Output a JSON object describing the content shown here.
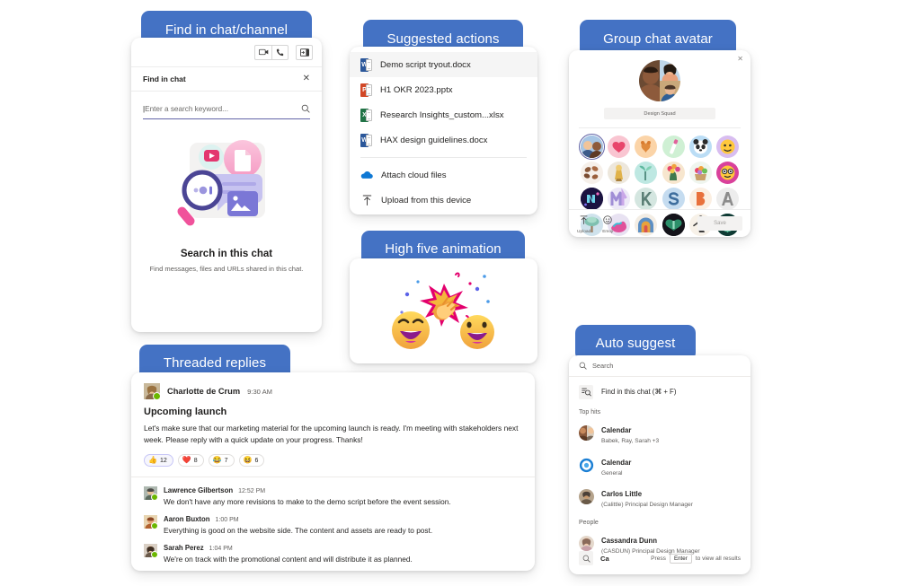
{
  "theme": {
    "tab_blue": "#4472C4",
    "accent_purple": "#6264A7",
    "presence_green": "#6BB700"
  },
  "tabs": {
    "find_in_chat_channel": "Find in chat/channel",
    "suggested_actions": "Suggested actions",
    "group_chat_avatar": "Group chat avatar",
    "high_five_animation": "High five animation",
    "threaded_replies": "Threaded replies",
    "auto_suggest": "Auto suggest"
  },
  "find_in_chat": {
    "toolbar_icons": [
      "video-camera-icon",
      "phone-icon",
      "open-panel-icon"
    ],
    "header_title": "Find in chat",
    "close_label": "✕",
    "search_placeholder": "Enter a search keyword...",
    "search_icon": "search-icon",
    "empty_title": "Search in this chat",
    "empty_subtitle": "Find messages, files and URLs shared in this chat."
  },
  "suggested_actions": {
    "files": [
      {
        "name": "Demo script tryout.docx",
        "type": "word",
        "badge": "W",
        "selected": true
      },
      {
        "name": "H1 OKR 2023.pptx",
        "type": "powerpoint",
        "badge": "P",
        "selected": false
      },
      {
        "name": "Research Insights_custom...xlsx",
        "type": "excel",
        "badge": "X",
        "selected": false
      },
      {
        "name": "HAX design guidelines.docx",
        "type": "word",
        "badge": "W",
        "selected": false
      }
    ],
    "actions": [
      {
        "label": "Attach cloud files",
        "icon": "cloud-icon"
      },
      {
        "label": "Upload from this device",
        "icon": "upload-arrow-icon"
      }
    ]
  },
  "group_chat_avatar": {
    "close_label": "✕",
    "group_name": "Design Squad",
    "avatar_options_count": 24,
    "selected_index": 0,
    "footer": {
      "upload_label": "Upload",
      "upload_icon": "upload-arrow-icon",
      "emoji_label": "Emoji",
      "emoji_icon": "smiley-icon",
      "save_label": "Save"
    }
  },
  "high_five": {
    "emoji_left": "😁",
    "emoji_right": "😁",
    "hands": "👏",
    "burst_color": "#E3006D"
  },
  "threaded_replies": {
    "author": "Charlotte de Crum",
    "time": "9:30 AM",
    "subject": "Upcoming launch",
    "body": "Let's make sure that our marketing material for the upcoming launch is ready. I'm meeting with stakeholders next week. Please reply with a quick update on your progress. Thanks!",
    "reactions": [
      {
        "emoji": "👍",
        "count": "12"
      },
      {
        "emoji": "❤️",
        "count": "8"
      },
      {
        "emoji": "😂",
        "count": "7"
      },
      {
        "emoji": "😆",
        "count": "6"
      }
    ],
    "replies": [
      {
        "author": "Lawrence Gilbertson",
        "time": "12:52 PM",
        "text": "We don't have any more revisions to make to the demo script before the event session."
      },
      {
        "author": "Aaron Buxton",
        "time": "1:00 PM",
        "text": "Everything is good on the website side. The content and assets are ready to post."
      },
      {
        "author": "Sarah Perez",
        "time": "1:04 PM",
        "text": "We're on track with the promotional content and will distribute it as planned."
      }
    ]
  },
  "auto_suggest": {
    "search_placeholder": "Search",
    "search_icon": "search-icon",
    "find_in_chat_label": "Find in this chat (⌘ + F)",
    "find_in_chat_icon": "filter-search-icon",
    "top_hits_label": "Top hits",
    "top_hits": [
      {
        "title": "Calendar",
        "subtitle": "Babek, Ray, Sarah +3",
        "avatar": "group-photo"
      },
      {
        "title": "Calendar",
        "subtitle": "General",
        "avatar": "teams-channel-icon"
      },
      {
        "title": "Carlos Little",
        "subtitle": "(Calittle) Principal Design Manager",
        "avatar": "person-photo"
      }
    ],
    "people_label": "People",
    "people": [
      {
        "title": "Cassandra Dunn",
        "subtitle": "(CASDUN) Principal Design Manager",
        "avatar": "person-photo"
      }
    ],
    "footer": {
      "query": "Ca",
      "press_label": "Press",
      "key_label": "Enter",
      "tail_label": "to view all results",
      "icon": "search-icon"
    }
  }
}
